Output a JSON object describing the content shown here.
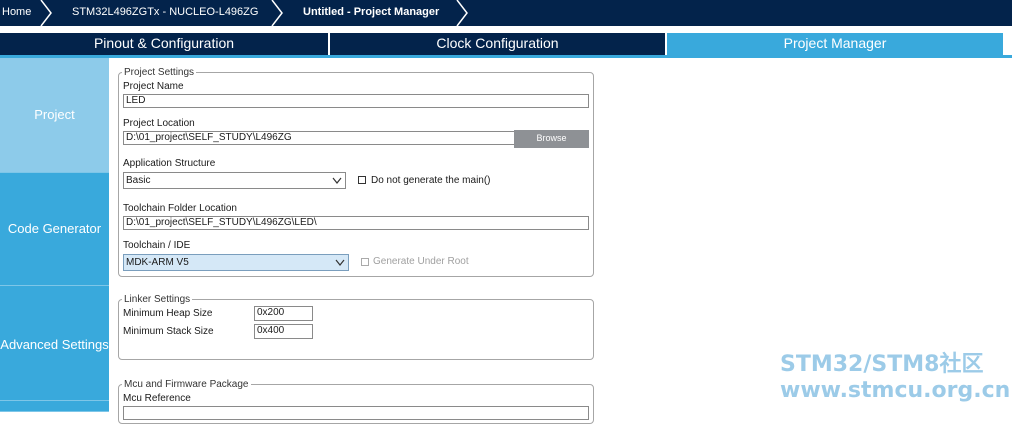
{
  "breadcrumb": {
    "home": "Home",
    "device": "STM32L496ZGTx  -  NUCLEO-L496ZG",
    "current": "Untitled - Project Manager"
  },
  "tabs": [
    {
      "label": "Pinout & Configuration",
      "active": false
    },
    {
      "label": "Clock Configuration",
      "active": false
    },
    {
      "label": "Project Manager",
      "active": true
    }
  ],
  "sidebar": {
    "items": [
      {
        "label": "Project",
        "active": true
      },
      {
        "label": "Code Generator",
        "active": false
      },
      {
        "label": "Advanced Settings",
        "active": false
      }
    ]
  },
  "project_settings": {
    "legend": "Project Settings",
    "project_name_label": "Project Name",
    "project_name_value": "LED",
    "project_location_label": "Project Location",
    "project_location_value": "D:\\01_project\\SELF_STUDY\\L496ZG",
    "browse_label": "Browse",
    "app_structure_label": "Application Structure",
    "app_structure_value": "Basic",
    "no_main_label": "Do not generate the main()",
    "no_main_checked": false,
    "toolchain_folder_label": "Toolchain Folder Location",
    "toolchain_folder_value": "D:\\01_project\\SELF_STUDY\\L496ZG\\LED\\",
    "toolchain_ide_label": "Toolchain / IDE",
    "toolchain_ide_value": "MDK-ARM V5",
    "gen_under_root_label": "Generate Under Root",
    "gen_under_root_checked": false
  },
  "linker_settings": {
    "legend": "Linker Settings",
    "heap_label": "Minimum Heap Size",
    "heap_value": "0x200",
    "stack_label": "Minimum Stack Size",
    "stack_value": "0x400"
  },
  "mcu_package": {
    "legend": "Mcu and Firmware Package",
    "mcu_reference_label": "Mcu Reference"
  },
  "watermark": {
    "line1": "STM32/STM8社区",
    "line2": "www.stmcu.org.cn"
  },
  "colors": {
    "header_navy": "#03234b",
    "accent_blue": "#39a9dc",
    "sidebar_active": "#8dcbea",
    "button_gray": "#8e9195"
  }
}
